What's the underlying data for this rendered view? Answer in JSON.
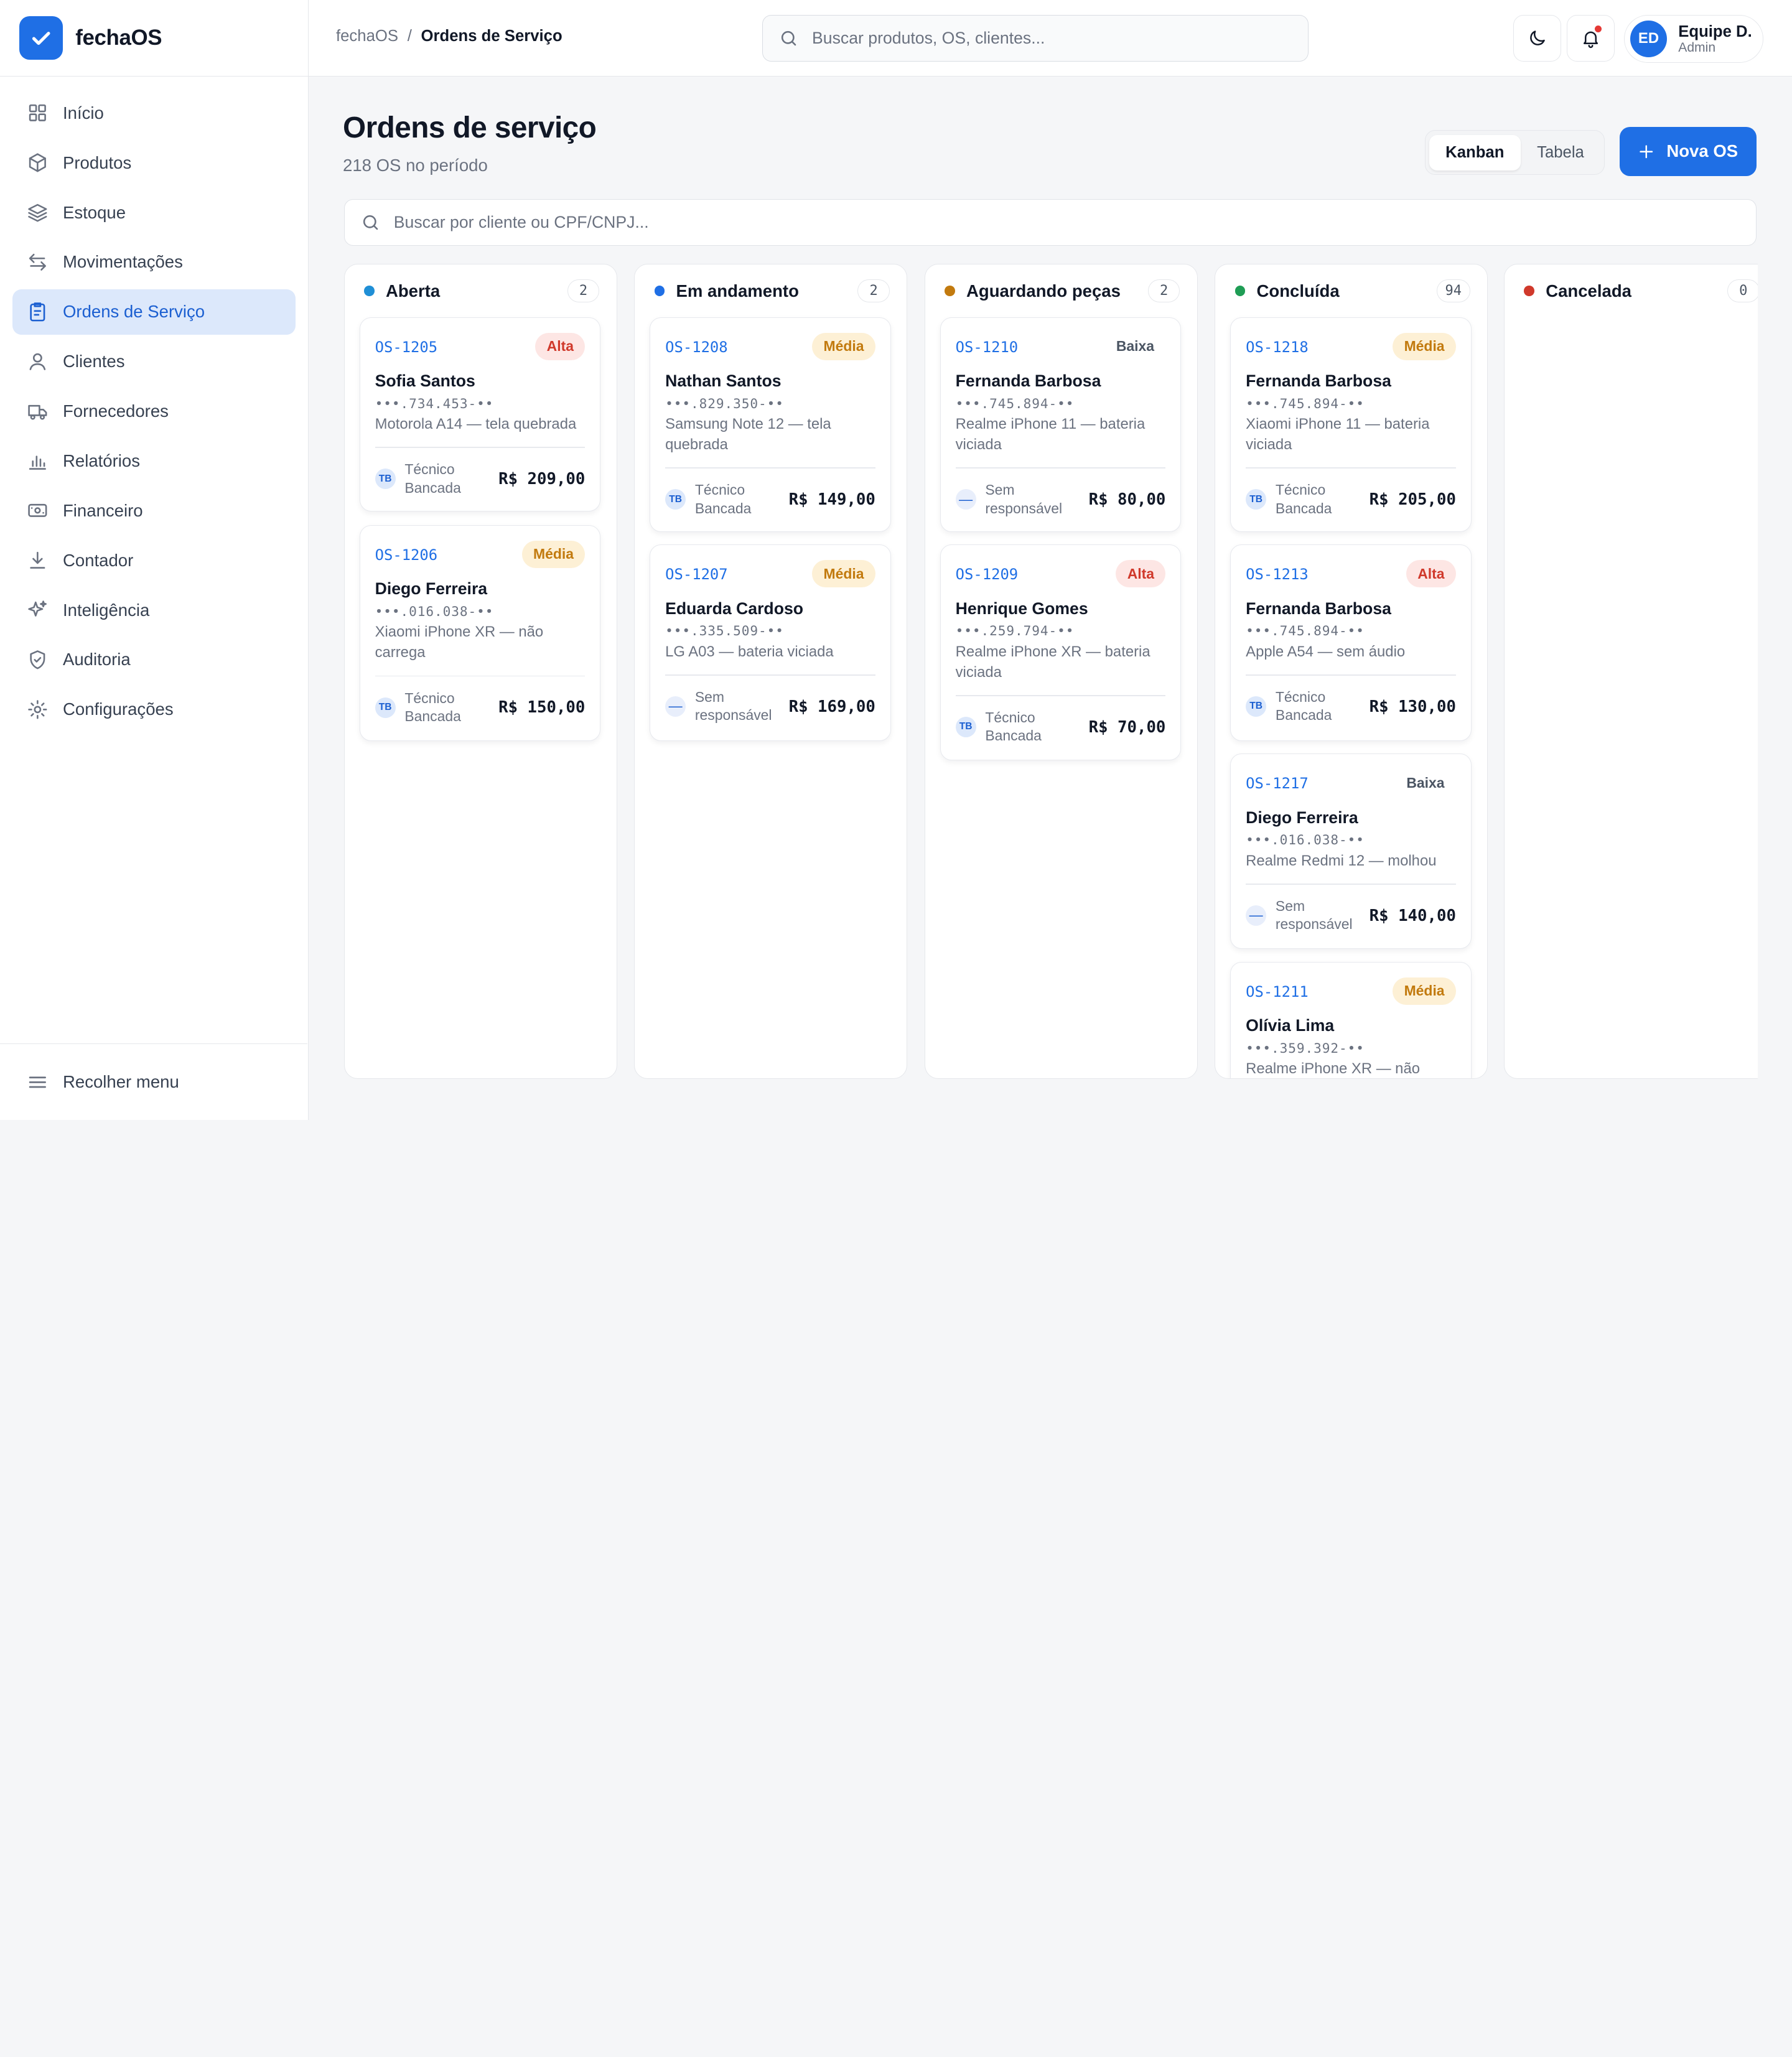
{
  "app": {
    "name": "fechaOS"
  },
  "sidebar": {
    "items": [
      {
        "label": "Início",
        "icon": "grid-icon",
        "active": false
      },
      {
        "label": "Produtos",
        "icon": "box-icon",
        "active": false
      },
      {
        "label": "Estoque",
        "icon": "layers-icon",
        "active": false
      },
      {
        "label": "Movimentações",
        "icon": "arrows-icon",
        "active": false
      },
      {
        "label": "Ordens de Serviço",
        "icon": "clipboard-icon",
        "active": true
      },
      {
        "label": "Clientes",
        "icon": "user-icon",
        "active": false
      },
      {
        "label": "Fornecedores",
        "icon": "truck-icon",
        "active": false
      },
      {
        "label": "Relatórios",
        "icon": "bar-chart-icon",
        "active": false
      },
      {
        "label": "Financeiro",
        "icon": "cash-icon",
        "active": false
      },
      {
        "label": "Contador",
        "icon": "download-icon",
        "active": false
      },
      {
        "label": "Inteligência",
        "icon": "sparkles-icon",
        "active": false
      },
      {
        "label": "Auditoria",
        "icon": "shield-check-icon",
        "active": false
      },
      {
        "label": "Configurações",
        "icon": "gear-icon",
        "active": false
      }
    ],
    "collapse_label": "Recolher menu"
  },
  "header": {
    "breadcrumb": {
      "root": "fechaOS",
      "separator": "/",
      "current": "Ordens de Serviço"
    },
    "search_placeholder": "Buscar produtos, OS, clientes...",
    "user": {
      "initials": "ED",
      "name": "Equipe D.",
      "role": "Admin"
    }
  },
  "main": {
    "title": "Ordens de serviço",
    "subtitle": "218 OS no período",
    "view_toggle": {
      "kanban": "Kanban",
      "tabela": "Tabela",
      "selected": "Kanban"
    },
    "new_button": "Nova OS",
    "search_placeholder": "Buscar por cliente ou CPF/CNPJ..."
  },
  "colors": {
    "accent": "#1f6fe5",
    "aberta": "#1f8fd6",
    "em_andamento": "#1f6fe5",
    "aguardando": "#c27a0e",
    "concluida": "#1f9d55",
    "cancelada": "#d0392b"
  },
  "columns": [
    {
      "title": "Aberta",
      "count": "2",
      "color": "#1f8fd6",
      "cards": [
        {
          "code": "OS-1205",
          "priority": "Alta",
          "client": "Sofia Santos",
          "doc": "•••.734.453-••",
          "device": "Motorola A14 — tela quebrada",
          "tech_initials": "TB",
          "tech": "Técnico Bancada",
          "price": "R$ 209,00"
        },
        {
          "code": "OS-1206",
          "priority": "Média",
          "client": "Diego Ferreira",
          "doc": "•••.016.038-••",
          "device": "Xiaomi iPhone XR — não carrega",
          "tech_initials": "TB",
          "tech": "Técnico Bancada",
          "price": "R$ 150,00"
        }
      ]
    },
    {
      "title": "Em andamento",
      "count": "2",
      "color": "#1f6fe5",
      "cards": [
        {
          "code": "OS-1208",
          "priority": "Média",
          "client": "Nathan Santos",
          "doc": "•••.829.350-••",
          "device": "Samsung Note 12 — tela quebrada",
          "tech_initials": "TB",
          "tech": "Técnico Bancada",
          "price": "R$ 149,00"
        },
        {
          "code": "OS-1207",
          "priority": "Média",
          "client": "Eduarda Cardoso",
          "doc": "•••.335.509-••",
          "device": "LG A03 — bateria viciada",
          "tech_initials": "—",
          "tech": "Sem responsável",
          "price": "R$ 169,00"
        }
      ]
    },
    {
      "title": "Aguardando peças",
      "count": "2",
      "color": "#c27a0e",
      "cards": [
        {
          "code": "OS-1210",
          "priority": "Baixa",
          "client": "Fernanda Barbosa",
          "doc": "•••.745.894-••",
          "device": "Realme iPhone 11 — bateria viciada",
          "tech_initials": "—",
          "tech": "Sem responsável",
          "price": "R$ 80,00"
        },
        {
          "code": "OS-1209",
          "priority": "Alta",
          "client": "Henrique Gomes",
          "doc": "•••.259.794-••",
          "device": "Realme iPhone XR — bateria viciada",
          "tech_initials": "TB",
          "tech": "Técnico Bancada",
          "price": "R$ 70,00"
        }
      ]
    },
    {
      "title": "Concluída",
      "count": "94",
      "color": "#1f9d55",
      "cards": [
        {
          "code": "OS-1218",
          "priority": "Média",
          "client": "Fernanda Barbosa",
          "doc": "•••.745.894-••",
          "device": "Xiaomi iPhone 11 — bateria viciada",
          "tech_initials": "TB",
          "tech": "Técnico Bancada",
          "price": "R$ 205,00"
        },
        {
          "code": "OS-1213",
          "priority": "Alta",
          "client": "Fernanda Barbosa",
          "doc": "•••.745.894-••",
          "device": "Apple A54 — sem áudio",
          "tech_initials": "TB",
          "tech": "Técnico Bancada",
          "price": "R$ 130,00"
        },
        {
          "code": "OS-1217",
          "priority": "Baixa",
          "client": "Diego Ferreira",
          "doc": "•••.016.038-••",
          "device": "Realme Redmi 12 — molhou",
          "tech_initials": "—",
          "tech": "Sem responsável",
          "price": "R$ 140,00"
        },
        {
          "code": "OS-1211",
          "priority": "Média",
          "client": "Olívia Lima",
          "doc": "•••.359.392-••",
          "device": "Realme iPhone XR — não",
          "tech_initials": "",
          "tech": "",
          "price": ""
        }
      ]
    },
    {
      "title": "Cancelada",
      "count": "0",
      "color": "#d0392b",
      "cards": []
    }
  ]
}
